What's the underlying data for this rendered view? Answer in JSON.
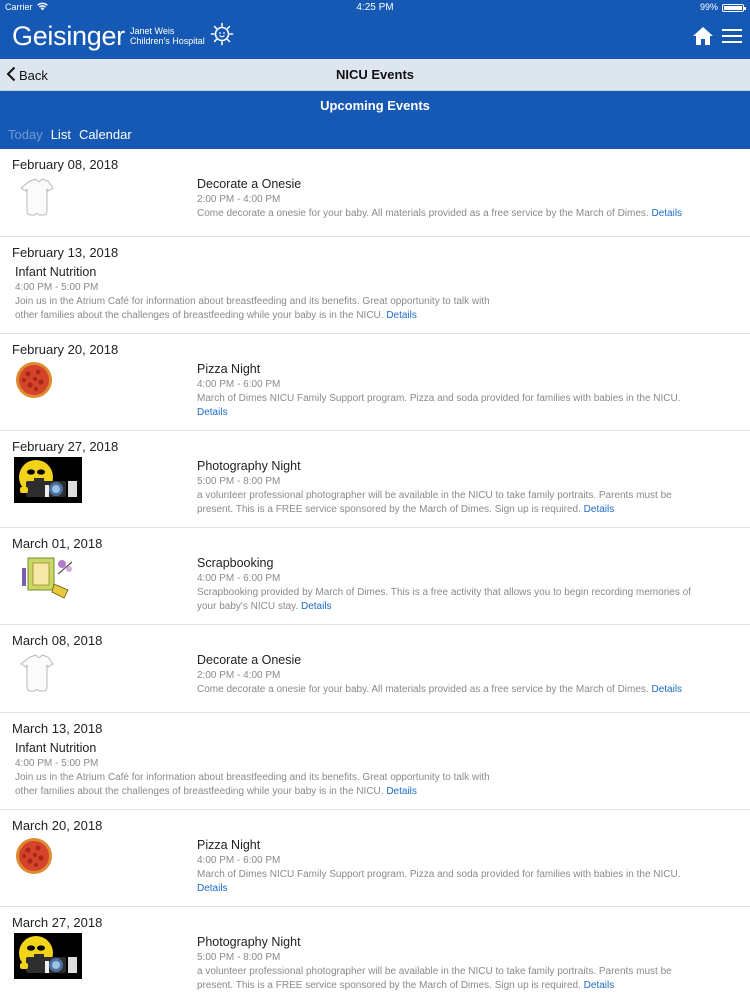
{
  "status_bar": {
    "carrier": "Carrier",
    "time": "4:25 PM",
    "battery": "99%"
  },
  "header": {
    "brand": "Geisinger",
    "subtitle_line1": "Janet Weis",
    "subtitle_line2": "Children's Hospital",
    "home_icon": "home-icon",
    "menu_icon": "hamburger-menu-icon",
    "accent_color": "#1559b4"
  },
  "nav": {
    "back_label": "Back",
    "title": "NICU Events"
  },
  "section": {
    "title": "Upcoming Events",
    "tabs": [
      {
        "label": "Today",
        "active": true
      },
      {
        "label": "List",
        "active": false
      },
      {
        "label": "Calendar",
        "active": false
      }
    ]
  },
  "events": [
    {
      "date": "February 08, 2018",
      "image": "onesie",
      "title": "Decorate a Onesie",
      "time": "2:00 PM - 4:00 PM",
      "description": "Come decorate a onesie for your baby. All materials provided as a free service by the March of Dimes.",
      "details": "Details"
    },
    {
      "date": "February 13, 2018",
      "image": null,
      "title": "Infant Nutrition",
      "time": "4:00 PM - 5:00 PM",
      "description_line1": "Join us in the Atrium Café for information about breastfeeding and its benefits. Great opportunity to talk with",
      "description_line2": "other families about the challenges of breastfeeding while your baby is in the NICU.",
      "details": "Details"
    },
    {
      "date": "February 20, 2018",
      "image": "pizza",
      "title": "Pizza Night",
      "time": "4:00 PM - 6:00 PM",
      "description": "March of Dimes NICU Family Support program. Pizza and soda provided for families with babies in the NICU.",
      "details": "Details"
    },
    {
      "date": "February 27, 2018",
      "image": "camera-smiley",
      "title": "Photography Night",
      "time": "5:00 PM - 8:00 PM",
      "description_line1": "a volunteer professional photographer will be available in the NICU to take family portraits. Parents must be",
      "description_line2": "present. This is a FREE service sponsored by the March of Dimes. Sign up is required.",
      "details": "Details"
    },
    {
      "date": "March 01, 2018",
      "image": "scrapbook",
      "title": "Scrapbooking",
      "time": "4:00 PM - 6:00 PM",
      "description_line1": "Scrapbooking provided by March of Dimes. This is a free activity that allows you to begin recording memories of",
      "description_line2": "your baby's NICU stay.",
      "details": "Details"
    },
    {
      "date": "March 08, 2018",
      "image": "onesie",
      "title": "Decorate a Onesie",
      "time": "2:00 PM - 4:00 PM",
      "description": "Come decorate a onesie for your baby. All materials provided as a free service by the March of Dimes.",
      "details": "Details"
    },
    {
      "date": "March 13, 2018",
      "image": null,
      "title": "Infant Nutrition",
      "time": "4:00 PM - 5:00 PM",
      "description_line1": "Join us in the Atrium Café for information about breastfeeding and its benefits. Great opportunity to talk with",
      "description_line2": "other families about the challenges of breastfeeding while your baby is in the NICU.",
      "details": "Details"
    },
    {
      "date": "March 20, 2018",
      "image": "pizza",
      "title": "Pizza Night",
      "time": "4:00 PM - 6:00 PM",
      "description": "March of Dimes NICU Family Support program. Pizza and soda provided for families with babies in the NICU.",
      "details": "Details"
    },
    {
      "date": "March 27, 2018",
      "image": "camera-smiley",
      "title": "Photography Night",
      "time": "5:00 PM - 8:00 PM",
      "description_line1": "a volunteer professional photographer will be available in the NICU to take family portraits. Parents must be",
      "description_line2": "present. This is a FREE service sponsored by the March of Dimes. Sign up is required.",
      "details": "Details"
    }
  ]
}
